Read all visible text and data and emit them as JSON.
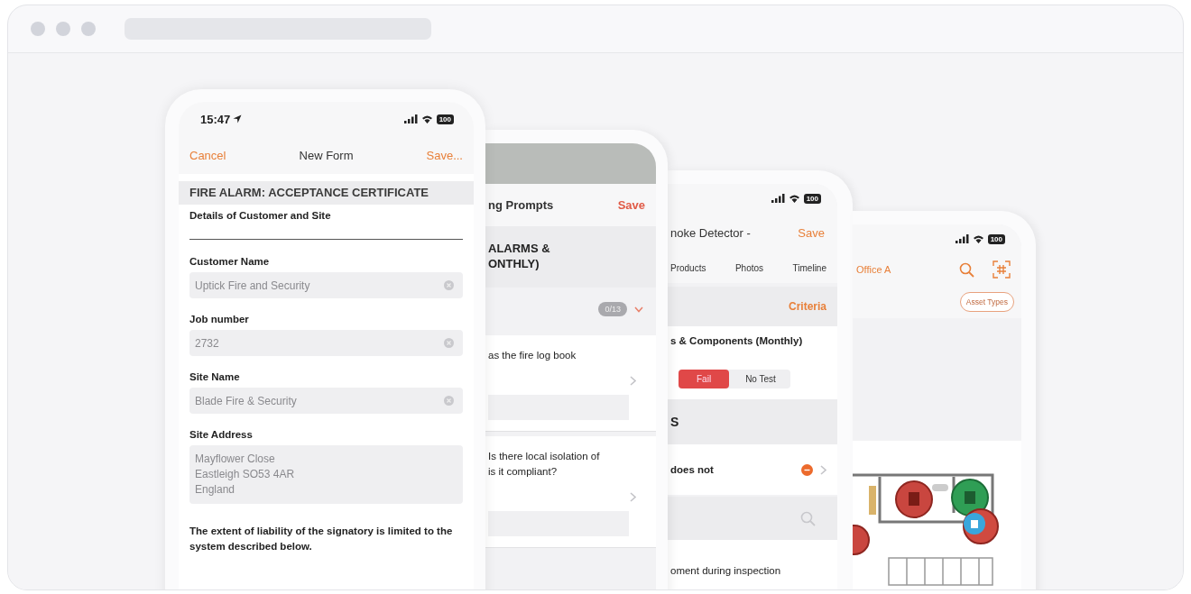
{
  "phones": [
    {
      "kind": "form",
      "status": {
        "time": "15:47",
        "battery": "100"
      },
      "nav": {
        "left": "Cancel",
        "title": "New Form",
        "right": "Save..."
      },
      "section": "FIRE ALARM: ACCEPTANCE CERTIFICATE",
      "subtitle": "Details of Customer and Site",
      "fields": [
        {
          "kind": "text",
          "label": "Customer Name",
          "value": "Uptick Fire and Security"
        },
        {
          "kind": "text",
          "label": "Job number",
          "value": "2732"
        },
        {
          "kind": "text",
          "label": "Site Name",
          "value": "Blade Fire & Security"
        },
        {
          "kind": "multiline",
          "label": "Site Address",
          "value": "Mayflower Close\nEastleigh SO53 4AR\nEngland"
        }
      ],
      "note": "The extent of liability of the signatory is limited to the system described below."
    },
    {
      "kind": "prompts",
      "nav": {
        "title": "ng Prompts",
        "right": "Save"
      },
      "heading_lines": [
        "ALARMS &",
        "ONTHLY)"
      ],
      "badge": "0/13",
      "questions": [
        {
          "lines": [
            "as the fire log book"
          ]
        },
        {
          "lines": [
            "Is there local isolation of",
            "is it compliant?"
          ]
        }
      ]
    },
    {
      "kind": "asset",
      "status": {
        "battery": "100"
      },
      "nav": {
        "title": "noke Detector -",
        "right": "Save"
      },
      "tabs": [
        "Products",
        "Photos",
        "Timeline"
      ],
      "criteria": "Criteria",
      "checklist_title": "s & Components (Monthly)",
      "segments": [
        {
          "label": "Fail",
          "selected": true
        },
        {
          "label": "No Test",
          "selected": false
        }
      ],
      "section": "S",
      "issue": "does not",
      "footer": "oment during inspection"
    },
    {
      "kind": "map",
      "status": {
        "battery": "100"
      },
      "location": "Office A",
      "filter": "Asset Types"
    }
  ]
}
